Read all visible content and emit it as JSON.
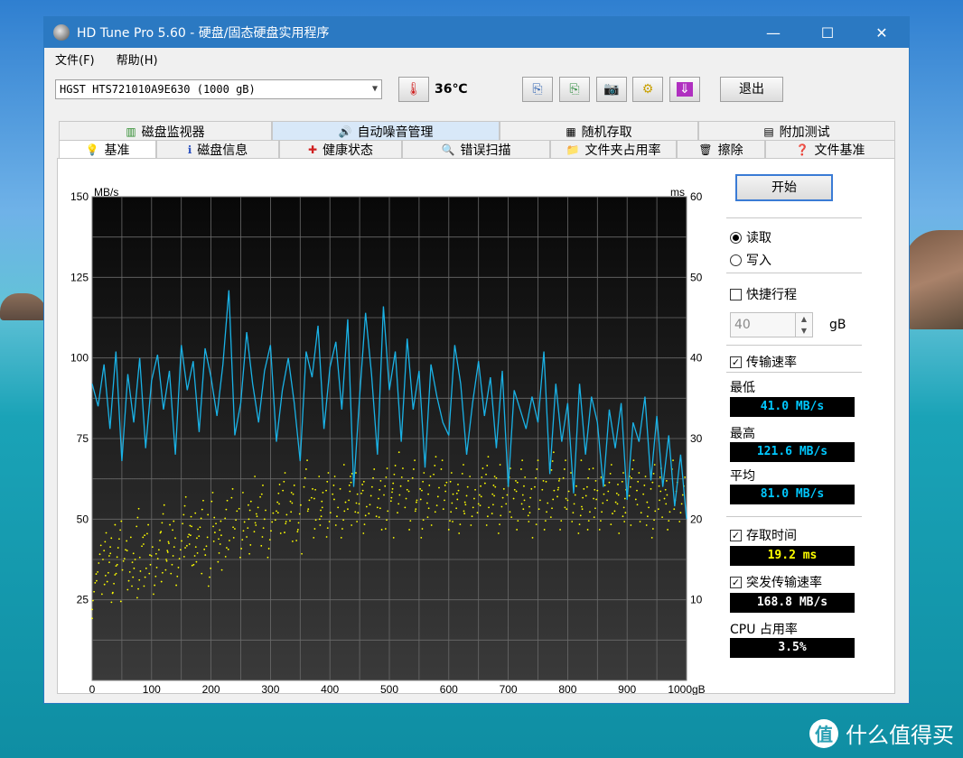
{
  "window": {
    "title": "HD Tune Pro 5.60 - 硬盘/固态硬盘实用程序",
    "controls": {
      "minimize": "—",
      "maximize": "☐",
      "close": "✕"
    }
  },
  "menu": {
    "file": "文件(F)",
    "help": "帮助(H)"
  },
  "toolbar": {
    "drive": "HGST HTS721010A9E630 (1000 gB)",
    "temperature": "36℃",
    "exit_label": "退出"
  },
  "tabs_top": [
    {
      "label": "磁盘监视器",
      "icon": "monitor-icon"
    },
    {
      "label": "自动噪音管理",
      "icon": "speaker-icon"
    },
    {
      "label": "随机存取",
      "icon": "random-access-icon"
    },
    {
      "label": "附加测试",
      "icon": "extra-tests-icon"
    }
  ],
  "tabs_bottom": [
    {
      "label": "基准",
      "icon": "benchmark-icon"
    },
    {
      "label": "磁盘信息",
      "icon": "info-icon"
    },
    {
      "label": "健康状态",
      "icon": "health-icon"
    },
    {
      "label": "错误扫描",
      "icon": "scan-icon"
    },
    {
      "label": "文件夹占用率",
      "icon": "folder-icon"
    },
    {
      "label": "擦除",
      "icon": "erase-icon"
    },
    {
      "label": "文件基准",
      "icon": "file-benchmark-icon"
    }
  ],
  "side": {
    "start_label": "开始",
    "read_label": "读取",
    "write_label": "写入",
    "short_stroke_label": "快捷行程",
    "short_stroke_value": "40",
    "short_stroke_unit": "gB",
    "transfer_rate_label": "传输速率",
    "min_label": "最低",
    "min_value": "41.0 MB/s",
    "max_label": "最高",
    "max_value": "121.6 MB/s",
    "avg_label": "平均",
    "avg_value": "81.0 MB/s",
    "access_time_label": "存取时间",
    "access_time_value": "19.2 ms",
    "burst_label": "突发传输速率",
    "burst_value": "168.8 MB/s",
    "cpu_label": "CPU 占用率",
    "cpu_value": "3.5%",
    "colors": {
      "transfer": "#00c8ff",
      "access": "#ffff00",
      "text": "#ffffff"
    }
  },
  "chart_data": {
    "type": "line",
    "ylabel_left": "MB/s",
    "ylabel_right": "ms",
    "x_unit": "gB",
    "x_ticks": [
      "0",
      "100",
      "200",
      "300",
      "400",
      "500",
      "600",
      "700",
      "800",
      "900",
      "1000"
    ],
    "y_left_ticks": [
      "25",
      "50",
      "75",
      "100",
      "125",
      "150"
    ],
    "y_right_ticks": [
      "10",
      "20",
      "30",
      "40",
      "50",
      "60"
    ],
    "xlim": [
      0,
      1000
    ],
    "ylim_left": [
      0,
      150
    ],
    "ylim_right": [
      0,
      60
    ],
    "series": [
      {
        "color": "#1ab2e6",
        "axis": "left",
        "x": [
          0,
          10,
          20,
          30,
          40,
          50,
          60,
          70,
          80,
          90,
          100,
          110,
          120,
          130,
          140,
          150,
          160,
          170,
          180,
          190,
          200,
          210,
          220,
          230,
          240,
          250,
          260,
          270,
          280,
          290,
          300,
          310,
          320,
          330,
          340,
          350,
          360,
          370,
          380,
          390,
          400,
          410,
          420,
          430,
          440,
          450,
          460,
          470,
          480,
          490,
          500,
          510,
          520,
          530,
          540,
          550,
          560,
          570,
          580,
          590,
          600,
          610,
          620,
          630,
          640,
          650,
          660,
          670,
          680,
          690,
          700,
          710,
          720,
          730,
          740,
          750,
          760,
          770,
          780,
          790,
          800,
          810,
          820,
          830,
          840,
          850,
          860,
          870,
          880,
          890,
          900,
          910,
          920,
          930,
          940,
          950,
          960,
          970,
          980,
          990,
          1000
        ],
        "y": [
          92,
          85,
          98,
          78,
          102,
          68,
          95,
          80,
          100,
          72,
          93,
          101,
          84,
          96,
          70,
          104,
          90,
          99,
          77,
          103,
          94,
          82,
          98,
          121,
          76,
          86,
          108,
          92,
          80,
          96,
          104,
          74,
          90,
          100,
          86,
          68,
          102,
          94,
          110,
          78,
          97,
          105,
          84,
          112,
          60,
          88,
          114,
          95,
          70,
          116,
          90,
          102,
          74,
          106,
          84,
          96,
          66,
          98,
          88,
          80,
          76,
          104,
          92,
          70,
          86,
          99,
          82,
          94,
          72,
          96,
          60,
          90,
          84,
          78,
          88,
          80,
          102,
          64,
          92,
          74,
          86,
          58,
          92,
          70,
          88,
          80,
          60,
          84,
          72,
          86,
          56,
          80,
          74,
          88,
          62,
          82,
          60,
          76,
          54,
          70,
          50
        ]
      }
    ],
    "scatter": {
      "color": "#ffff00",
      "axis": "right",
      "note_values_ms": "access time samples mostly 10–28 ms",
      "x": [
        5,
        12,
        20,
        28,
        35,
        42,
        50,
        58,
        66,
        74,
        82,
        90,
        98,
        106,
        114,
        122,
        130,
        138,
        146,
        154,
        162,
        170,
        178,
        186,
        194,
        202,
        210,
        220,
        230,
        240,
        250,
        260,
        270,
        280,
        290,
        300,
        310,
        320,
        330,
        340,
        350,
        360,
        370,
        380,
        390,
        400,
        410,
        420,
        430,
        440,
        450,
        460,
        470,
        480,
        490,
        500,
        510,
        520,
        530,
        540,
        550,
        560,
        570,
        580,
        590,
        600,
        610,
        620,
        630,
        640,
        650,
        660,
        670,
        680,
        690,
        700,
        710,
        720,
        730,
        740,
        750,
        760,
        770,
        780,
        790,
        800,
        810,
        820,
        830,
        840,
        850,
        860,
        870,
        880,
        890,
        900,
        910,
        920,
        930,
        940,
        950,
        960,
        970,
        980,
        990
      ],
      "y": [
        11,
        14,
        15,
        13,
        16,
        12,
        17,
        14,
        15,
        13,
        18,
        15,
        16,
        14,
        19,
        15,
        17,
        16,
        14,
        20,
        17,
        18,
        16,
        19,
        15,
        20,
        18,
        17,
        19,
        21,
        18,
        20,
        19,
        22,
        20,
        18,
        21,
        23,
        20,
        22,
        19,
        24,
        21,
        22,
        20,
        23,
        22,
        21,
        24,
        22,
        23,
        21,
        24,
        22,
        23,
        21,
        25,
        23,
        22,
        24,
        21,
        23,
        22,
        25,
        24,
        22,
        23,
        21,
        24,
        22,
        23,
        25,
        22,
        24,
        21,
        23,
        22,
        24,
        23,
        21,
        24,
        22,
        23,
        25,
        22,
        24,
        23,
        21,
        24,
        22,
        23,
        22,
        24,
        21,
        23,
        22,
        24,
        23,
        22,
        21,
        24,
        23,
        22,
        24,
        23
      ]
    }
  }
}
